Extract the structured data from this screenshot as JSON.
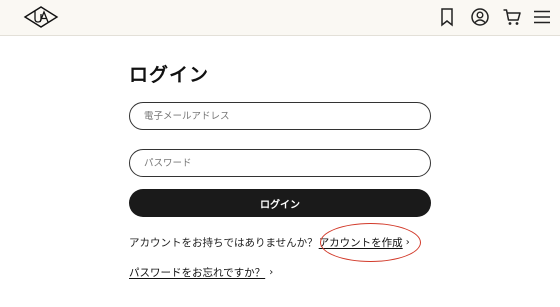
{
  "header": {
    "logo_icon": "ua-logo-icon",
    "icons": [
      "bookmark-icon",
      "account-icon",
      "cart-icon",
      "menu-icon"
    ]
  },
  "page": {
    "title": "ログイン"
  },
  "form": {
    "email_placeholder": "電子メールアドレス",
    "email_value": "",
    "password_placeholder": "パスワード",
    "password_value": "",
    "login_label": "ログイン"
  },
  "signup": {
    "prompt": "アカウントをお持ちではありませんか？",
    "link_label": "アカウントを作成",
    "chevron": "›"
  },
  "forgot": {
    "link_label": "パスワードをお忘れですか？",
    "chevron": "›"
  },
  "colors": {
    "header_bg": "#faf8f3",
    "button_bg": "#1a1a1a",
    "highlight": "#d23a2a"
  }
}
